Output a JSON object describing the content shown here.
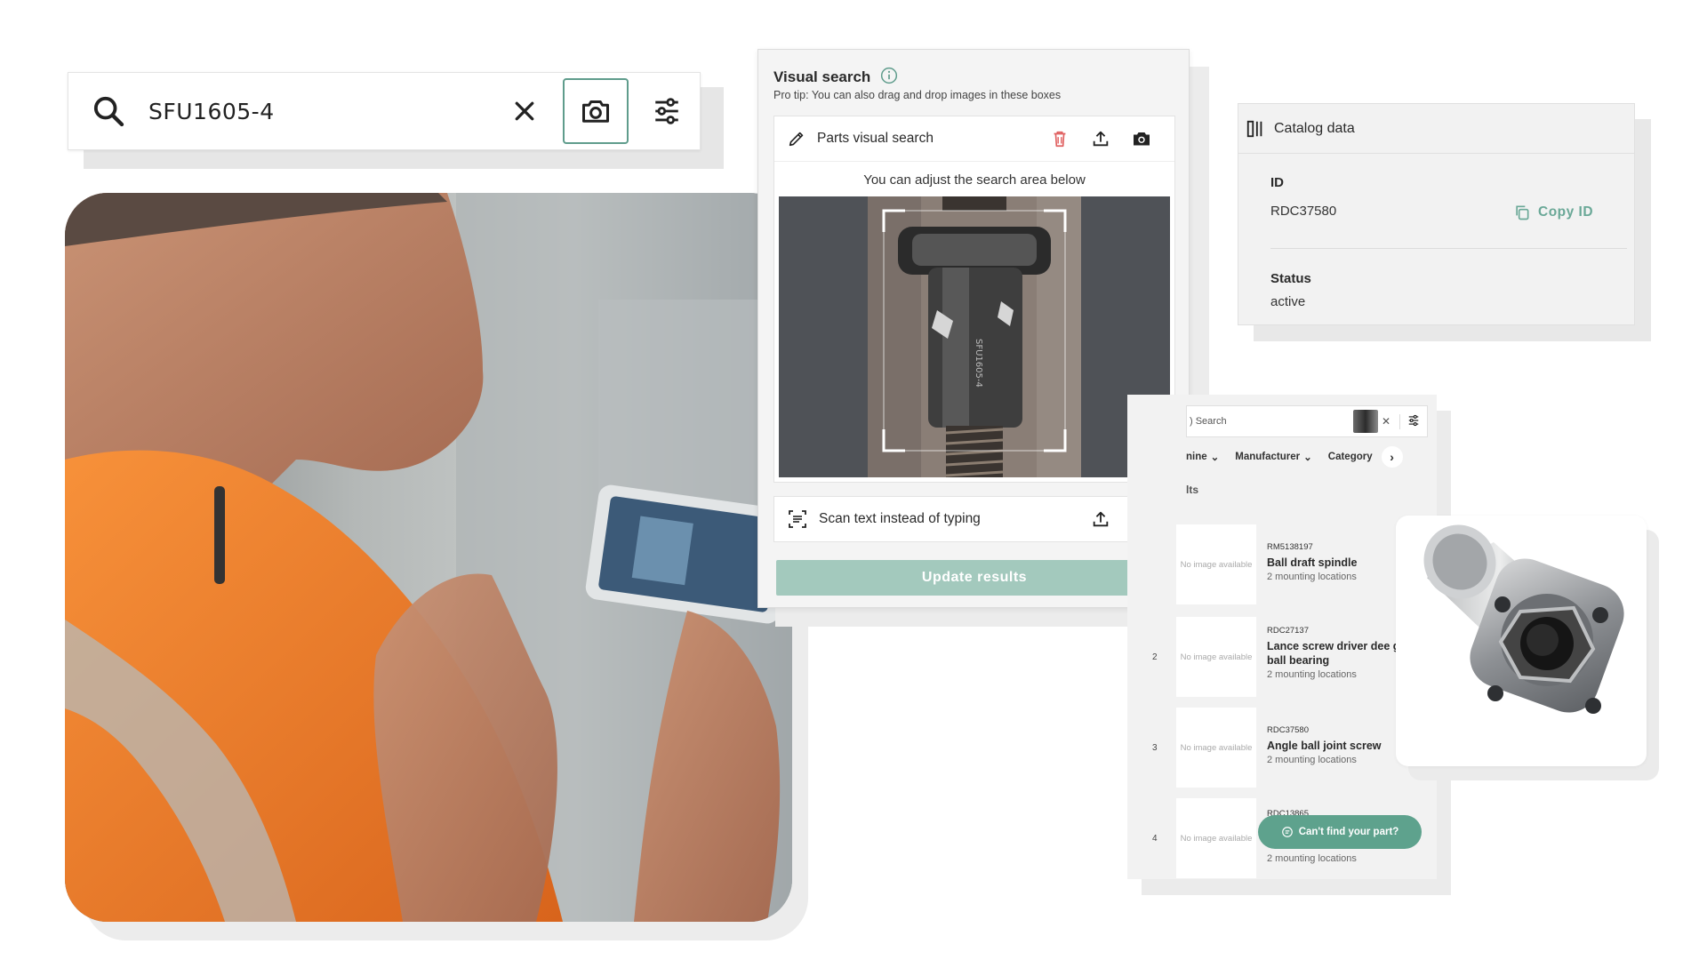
{
  "search_bar": {
    "query": "SFU1605-4"
  },
  "visual_search": {
    "title": "Visual search",
    "tip": "Pro tip: You can also drag and drop images in these boxes",
    "parts_label": "Parts visual search",
    "adjust_text": "You can adjust the search area below",
    "scan_label": "Scan text instead of typing",
    "update_button": "Update results",
    "image_part_text": "SFU1605-4"
  },
  "catalog": {
    "header": "Catalog data",
    "id_label": "ID",
    "id_value": "RDC37580",
    "copy_label": "Copy ID",
    "status_label": "Status",
    "status_value": "active"
  },
  "results": {
    "search_placeholder": ") Search",
    "filters": [
      "nine",
      "Manufacturer",
      "Category"
    ],
    "heading": "lts",
    "items": [
      {
        "num": "",
        "img": "No image available",
        "code": "RM5138197",
        "name": "Ball draft spindle",
        "loc": "2 mounting locations"
      },
      {
        "num": "2",
        "img": "No image available",
        "code": "RDC27137",
        "name": "Lance screw driver dee groove ball bearing",
        "loc": "2 mounting locations"
      },
      {
        "num": "3",
        "img": "No image available",
        "code": "RDC37580",
        "name": "Angle ball joint screw",
        "loc": "2 mounting locations"
      },
      {
        "num": "4",
        "img": "No image available",
        "code": "RDC13865",
        "name": "",
        "loc": "2 mounting locations"
      }
    ],
    "cant_find": "Can't find your part?"
  },
  "colors": {
    "accent": "#5f9c8c",
    "update_button": "#a3c9bd",
    "vest_orange": "#f07c28",
    "delete_red": "#e06060"
  }
}
